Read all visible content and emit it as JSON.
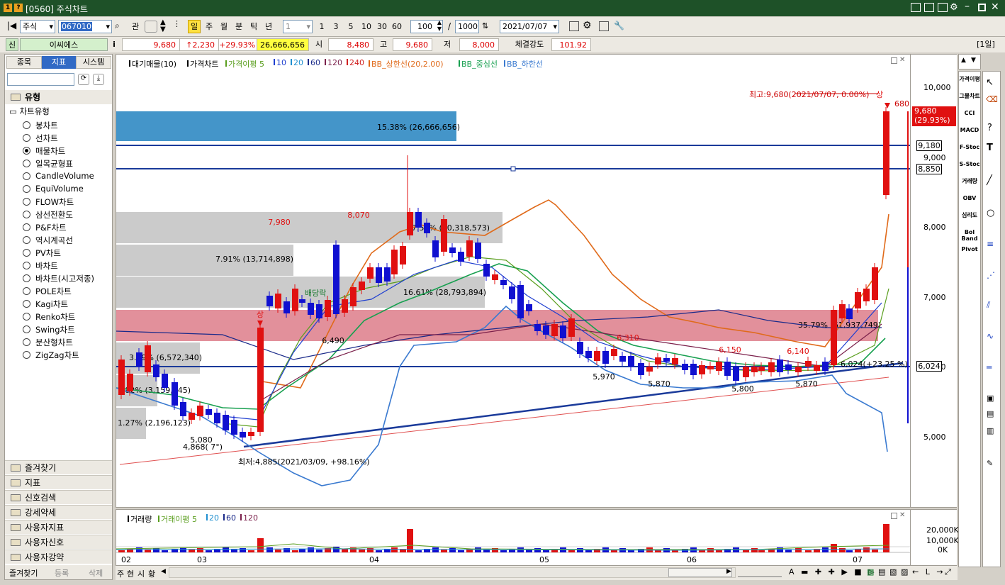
{
  "window": {
    "title": "[0560] 주식차트",
    "icon_labels": [
      "1",
      "?"
    ]
  },
  "toolbar": {
    "market_select": "주식",
    "code_input": "067010",
    "period_buttons": [
      "관"
    ],
    "periods": [
      "일",
      "주",
      "월",
      "분",
      "틱",
      "년"
    ],
    "interval_select": "1",
    "interval_shortcuts": [
      "1",
      "3",
      "5",
      "10",
      "30",
      "60"
    ],
    "count_value": "100",
    "count_separator": "/",
    "count_max": "1000",
    "date_value": "2021/07/07"
  },
  "quote": {
    "badge": "신",
    "stock_name": "이씨에스",
    "info_icon": "i",
    "price": "9,680",
    "change": "↑2,230",
    "change_pct": "+29.93%",
    "volume": "26,666,656",
    "open_label": "시",
    "open": "8,480",
    "high_label": "고",
    "high": "9,680",
    "low_label": "저",
    "low": "8,000",
    "strength_label": "체결강도",
    "strength": "101.92",
    "corner_label": "[1일]"
  },
  "left_panel": {
    "tabs": [
      "종목",
      "지표",
      "시스템"
    ],
    "active_tab": "지표",
    "section_title": "유형",
    "group_title": "차트유형",
    "chart_types": [
      "봉차트",
      "선차트",
      "매물차트",
      "일목균형표",
      "CandleVolume",
      "EquiVolume",
      "FLOW차트",
      "삼선전환도",
      "P&F차트",
      "역시계곡선",
      "PV차트",
      "바차트",
      "바차트(시고저종)",
      "POLE차트",
      "Kagi차트",
      "Renko차트",
      "Swing차트",
      "분산형차트",
      "ZigZag차트"
    ],
    "selected_type": "매물차트",
    "folders": [
      "즐겨찾기",
      "지표",
      "신호검색",
      "강세약세",
      "사용자지표",
      "사용자신호",
      "사용자강약"
    ],
    "bottom_buttons": [
      "즐겨찾기",
      "등록",
      "삭제"
    ]
  },
  "price_chart": {
    "legend": [
      {
        "text": "대기매물(10)",
        "color": "#000000"
      },
      {
        "text": "가격차트",
        "color": "#000000"
      },
      {
        "text": "가격이평 5",
        "color": "#5a9e1e"
      },
      {
        "text": "10",
        "color": "#1f3fd0"
      },
      {
        "text": "20",
        "color": "#1f8fd0"
      },
      {
        "text": "60",
        "color": "#1a2a8a"
      },
      {
        "text": "120",
        "color": "#7a1f4a"
      },
      {
        "text": "240",
        "color": "#d02020"
      },
      {
        "text": "BB_상한선(20,2.00)",
        "color": "#e06a1a"
      },
      {
        "text": "BB_중심선",
        "color": "#18a050"
      },
      {
        "text": "BB_하한선",
        "color": "#3a7ad0"
      }
    ],
    "y_ticks": [
      "10,000",
      "9,000",
      "8,000",
      "7,000",
      "6,000",
      "5,000"
    ],
    "price_tags": {
      "current": "9,680",
      "current_pct": "(29.93%)",
      "line1": "9,180",
      "line2": "8,850",
      "line3": "6,024"
    },
    "volume_profile_labels": [
      "15.38% (26,666,656)",
      "17.51% (30,318,573)",
      "7.91% (13,714,898)",
      "16.61% (28,793,894)",
      "35.79% (61,937,749)",
      "3.79% (6,572,340)",
      "1.82% (3,159,945)",
      "1.27% (2,196,123)"
    ],
    "annotations": {
      "max": "최고:9,680(2021/07/07, 0.00%)",
      "max_marker": "상",
      "max_short": "680",
      "min": "최저:4,885(2021/03/09, +98.16%)",
      "trend_label": "6,024(+23.25 %)",
      "low_label": "4,868( 7°)",
      "upper_mark": "상",
      "dividend_label": "배당락",
      "peaks": [
        "7,980",
        "8,070",
        "6,310",
        "6,150",
        "6,140"
      ],
      "troughs": [
        "5,080",
        "6,490",
        "5,970",
        "5,870",
        "5,800",
        "5,870"
      ]
    }
  },
  "volume_chart": {
    "legend": [
      {
        "text": "거래량",
        "color": "#000000"
      },
      {
        "text": "거래이평 5",
        "color": "#5a9e1e"
      },
      {
        "text": "20",
        "color": "#1f8fd0"
      },
      {
        "text": "60",
        "color": "#1a2a8a"
      },
      {
        "text": "120",
        "color": "#7a1f4a"
      }
    ],
    "y_ticks": [
      "20,000K",
      "10,000K",
      "0K"
    ]
  },
  "x_axis": [
    "02",
    "03",
    "04",
    "05",
    "06",
    "07"
  ],
  "bottom_tabs": [
    "주",
    "현",
    "시",
    "황"
  ],
  "right_tools": [
    "가격이평",
    "그물차트",
    "CCI",
    "MACD",
    "F-Stoc",
    "S-Stoc",
    "거래량",
    "OBV",
    "심리도",
    "Bol Band",
    "Pivot"
  ],
  "chart_data": {
    "type": "candlestick",
    "x_range": [
      "2021-02",
      "2021-07-07"
    ],
    "ylim": [
      4600,
      10300
    ],
    "notable_values": {
      "high": 9680,
      "low": 4885,
      "last_close": 9680,
      "last_open": 8480,
      "last_low": 8000
    },
    "volume_profile_pct": [
      15.38,
      17.51,
      7.91,
      16.61,
      35.79,
      3.79,
      1.82,
      1.27
    ]
  },
  "colors": {
    "up": "#e01010",
    "down": "#1010d0",
    "title_bar": "#1e5128",
    "highlight": "#ffff40"
  }
}
